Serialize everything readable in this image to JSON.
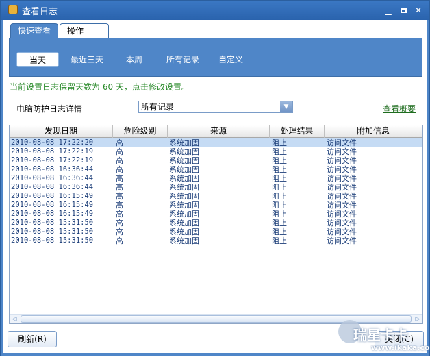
{
  "window": {
    "title": "查看日志",
    "controls": {
      "minimize": "▁",
      "close": "✕"
    }
  },
  "tabs": [
    {
      "label": "快速查看",
      "active": true
    },
    {
      "label": "操作",
      "active": false
    }
  ],
  "filters": [
    {
      "label": "当天",
      "active": true
    },
    {
      "label": "最近三天",
      "active": false
    },
    {
      "label": "本周",
      "active": false
    },
    {
      "label": "所有记录",
      "active": false
    },
    {
      "label": "自定义",
      "active": false
    }
  ],
  "notice": "当前设置日志保留天数为 60 天，点击修改设置。",
  "log_section": {
    "label": "电脑防护日志详情",
    "select_value": "所有记录",
    "summary_link": "查看概要"
  },
  "table": {
    "columns": [
      "发现日期",
      "危险级别",
      "来源",
      "处理结果",
      "附加信息"
    ],
    "rows": [
      [
        "2010-08-08 17:22:20",
        "高",
        "系统加固",
        "阻止",
        "访问文件"
      ],
      [
        "2010-08-08 17:22:19",
        "高",
        "系统加固",
        "阻止",
        "访问文件"
      ],
      [
        "2010-08-08 17:22:19",
        "高",
        "系统加固",
        "阻止",
        "访问文件"
      ],
      [
        "2010-08-08 16:36:44",
        "高",
        "系统加固",
        "阻止",
        "访问文件"
      ],
      [
        "2010-08-08 16:36:44",
        "高",
        "系统加固",
        "阻止",
        "访问文件"
      ],
      [
        "2010-08-08 16:36:44",
        "高",
        "系统加固",
        "阻止",
        "访问文件"
      ],
      [
        "2010-08-08 16:15:49",
        "高",
        "系统加固",
        "阻止",
        "访问文件"
      ],
      [
        "2010-08-08 16:15:49",
        "高",
        "系统加固",
        "阻止",
        "访问文件"
      ],
      [
        "2010-08-08 16:15:49",
        "高",
        "系统加固",
        "阻止",
        "访问文件"
      ],
      [
        "2010-08-08 15:31:50",
        "高",
        "系统加固",
        "阻止",
        "访问文件"
      ],
      [
        "2010-08-08 15:31:50",
        "高",
        "系统加固",
        "阻止",
        "访问文件"
      ],
      [
        "2010-08-08 15:31:50",
        "高",
        "系统加固",
        "阻止",
        "访问文件"
      ]
    ],
    "selected_row": 0
  },
  "buttons": {
    "refresh_label": "刷新",
    "refresh_key": "R",
    "close_label": "关闭",
    "close_key": "C"
  },
  "watermark": {
    "brand": "瑞星卡卡",
    "url": "www.ikaka.com"
  },
  "colors": {
    "window_blue": "#4f86c8",
    "notice_green": "#2a8a2a",
    "row_text": "#1b3d78",
    "selected_row": "#c5dbf4"
  },
  "icons": [
    "app-icon",
    "minimize-icon",
    "maximize-icon",
    "close-icon",
    "dropdown-arrow-icon",
    "scroll-left-icon",
    "scroll-right-icon"
  ]
}
